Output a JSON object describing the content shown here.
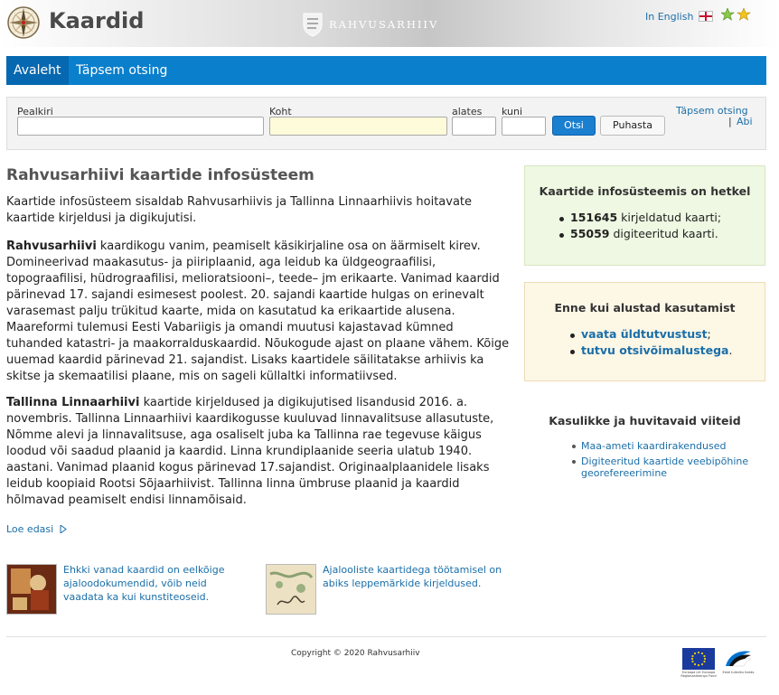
{
  "header": {
    "app_title": "Kaardid",
    "archive_name": "RAHVUSARHIIV",
    "lang_link": "In English",
    "logo_icon": "compass-rose-icon"
  },
  "nav": {
    "tabs": [
      "Avaleht",
      "Täpsem otsing"
    ],
    "active": "Avaleht"
  },
  "search": {
    "fields": {
      "title": "Pealkiri",
      "place": "Koht",
      "from": "alates",
      "to": "kuni"
    },
    "search_button": "Otsi",
    "clear_button": "Puhasta",
    "advanced_link": "Täpsem otsing",
    "separator": "|",
    "help_link": "Abi"
  },
  "main": {
    "title": "Rahvusarhiivi kaartide infosüsteem",
    "intro": "Kaartide infosüsteem sisaldab Rahvusarhiivis ja Tallinna Linnaarhiivis hoitavate kaartide kirjeldusi ja digikujutisi.",
    "p2_bold": "Rahvusarhiivi",
    "p2_text": " kaardikogu vanim, peamiselt käsikirjaline osa on äärmiselt kirev. Domineerivad maakasutus- ja piiriplaanid, aga leidub ka üldgeograafilisi, topograafilisi, hüdrograafilisi, melioratsiooni–, teede– jm erikaarte. Vanimad kaardid pärinevad 17. sajandi esimesest poolest. 20. sajandi kaartide hulgas on erinevalt varasemast palju trükitud kaarte, mida on kasutatud ka erikaartide alusena. Maareformi tulemusi Eesti Vabariigis ja omandi muutusi kajastavad kümned tuhanded katastri- ja maakorralduskaardid. Nõukogude ajast on plaane vähem. Kõige uuemad kaardid pärinevad 21. sajandist. Lisaks kaartidele säilitatakse arhiivis ka skitse ja skemaatilisi plaane, mis on sageli küllaltki informatiivsed.",
    "p3_bold": "Tallinna Linnaarhiivi",
    "p3_text": " kaartide kirjeldused ja digikujutised lisandusid 2016. a. novembris. Tallinna Linnaarhiivi kaardikogusse kuuluvad linnavalitsuse allasutuste, Nõmme alevi ja linnavalitsuse, aga osaliselt juba ka Tallinna rae tegevuse käigus loodud või saadud plaanid ja kaardid. Linna krundiplaanide seeria ulatub 1940. aastani. Vanimad plaanid kogus pärinevad 17.sajandist. Originaalplaanidele lisaks leidub koopiaid Rootsi Sõjaarhiivist. Tallinna linna ümbruse plaanid ja kaardid hõlmavad peamiselt endisi linnamõisaid.",
    "read_more": "Loe edasi",
    "features": [
      {
        "text": "Ehkki vanad kaardid on eelkõige ajaloodokumendid, võib neid vaadata ka kui kunstiteoseid."
      },
      {
        "text": "Ajalooliste kaartidega töötamisel on abiks leppemärkide kirjeldused."
      }
    ]
  },
  "sidebar": {
    "stats_title": "Kaartide infosüsteemis on hetkel",
    "stats": [
      {
        "num": "151645",
        "label": " kirjeldatud kaarti;"
      },
      {
        "num": "55059",
        "label": " digiteeritud kaarti."
      }
    ],
    "start_title": "Enne kui alustad kasutamist",
    "start_items": [
      {
        "link": "vaata üldtutvustust",
        "suffix": ";"
      },
      {
        "link": "tutvu otsivõimalustega",
        "suffix": "."
      }
    ],
    "links_title": "Kasulikke ja huvitavaid viiteid",
    "links": [
      "Maa-ameti kaardirakendused",
      "Digiteeritud kaartide veebipõhine georefereerimine"
    ]
  },
  "footer": {
    "copyright": "Copyright © 2020 Rahvusarhiiv",
    "eu_text": "Euroopa Liit Euroopa Regionaalarengu Fond",
    "ee_text": "Eesti tuleviku heaks"
  },
  "colors": {
    "nav": "#0a7fcc",
    "link": "#1a6ea8",
    "green_box": "#eef8e2",
    "yellow_box": "#fdf7e6"
  }
}
